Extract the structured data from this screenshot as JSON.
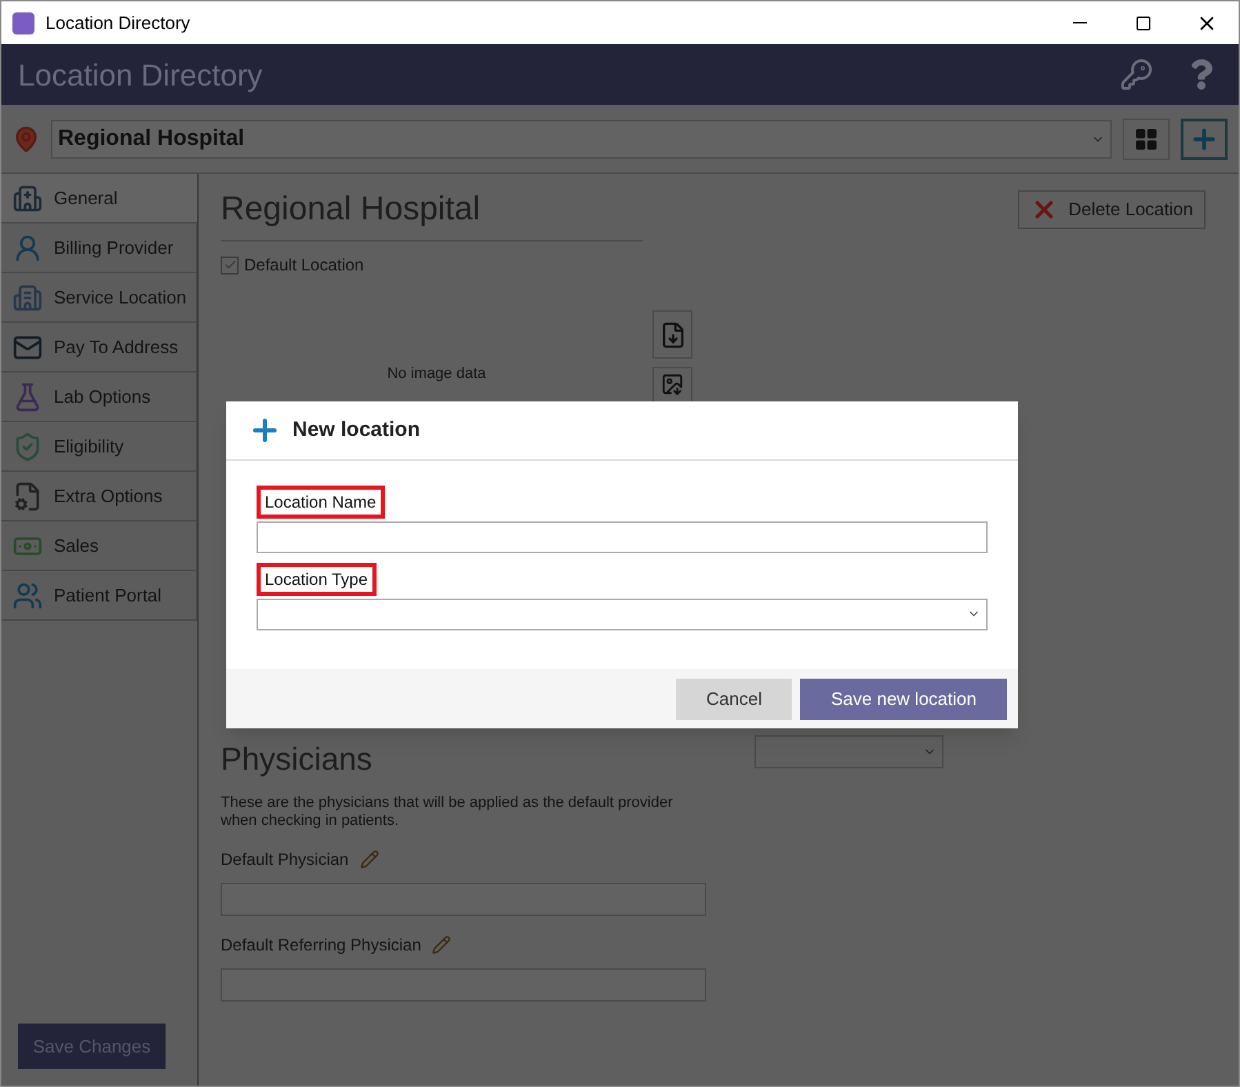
{
  "window": {
    "title": "Location Directory"
  },
  "header": {
    "title": "Location Directory"
  },
  "location_select": {
    "value": "Regional Hospital"
  },
  "sidebar": {
    "items": [
      {
        "label": "General",
        "selected": true
      },
      {
        "label": "Billing Provider",
        "selected": false
      },
      {
        "label": "Service Location",
        "selected": false
      },
      {
        "label": "Pay To Address",
        "selected": false
      },
      {
        "label": "Lab Options",
        "selected": false
      },
      {
        "label": "Eligibility",
        "selected": false
      },
      {
        "label": "Extra Options",
        "selected": false
      },
      {
        "label": "Sales",
        "selected": false
      },
      {
        "label": "Patient Portal",
        "selected": false
      }
    ]
  },
  "content": {
    "title": "Regional Hospital",
    "default_location": {
      "label": "Default Location",
      "checked": true
    },
    "delete_button": "Delete Location",
    "image_placeholder": "No image data",
    "physicians": {
      "title": "Physicians",
      "description": "These are the physicians that will be applied as the default provider when checking in patients.",
      "fields": [
        {
          "label": "Default Physician"
        },
        {
          "label": "Default Referring Physician"
        }
      ]
    }
  },
  "save_button": "Save Changes",
  "dialog": {
    "title": "New location",
    "fields": [
      {
        "label": "Location Name",
        "kind": "text",
        "highlighted": true
      },
      {
        "label": "Location Type",
        "kind": "select",
        "highlighted": true
      }
    ],
    "buttons": [
      {
        "label": "Cancel",
        "kind": "secondary"
      },
      {
        "label": "Save new location",
        "kind": "primary"
      }
    ]
  }
}
